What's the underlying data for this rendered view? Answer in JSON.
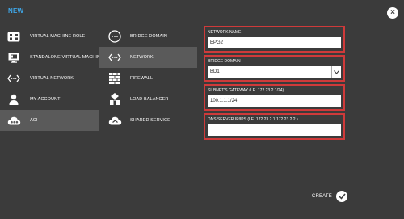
{
  "dialog": {
    "title": "NEW",
    "close_icon": "close-icon"
  },
  "categories": [
    {
      "label": "VIRTUAL MACHINE ROLE",
      "icon": "vm-role-icon",
      "selected": false
    },
    {
      "label": "STANDALONE VIRTUAL MACHINE",
      "icon": "monitor-icon",
      "selected": false
    },
    {
      "label": "VIRTUAL NETWORK",
      "icon": "network-arrows-icon",
      "selected": false
    },
    {
      "label": "MY ACCOUNT",
      "icon": "user-icon",
      "selected": false
    },
    {
      "label": "ACI",
      "icon": "aci-cloud-icon",
      "selected": true
    }
  ],
  "subtypes": [
    {
      "label": "BRIDGE DOMAIN",
      "icon": "bridge-domain-icon",
      "selected": false
    },
    {
      "label": "NETWORK",
      "icon": "network-arrows-icon",
      "selected": true
    },
    {
      "label": "FIREWALL",
      "icon": "firewall-icon",
      "selected": false
    },
    {
      "label": "LOAD BALANCER",
      "icon": "load-balancer-icon",
      "selected": false
    },
    {
      "label": "SHARED SERVICE",
      "icon": "shared-service-icon",
      "selected": false
    }
  ],
  "form": {
    "network_name": {
      "label": "NETWORK NAME",
      "value": "EPG2"
    },
    "bridge_domain": {
      "label": "BRIDGE DOMAIN",
      "value": "BD1"
    },
    "subnet_gateway": {
      "label": "SUBNET'S GATEWAY (I.E. 172.23.2.1/24)",
      "value": "100.1.1.1/24"
    },
    "dns_server": {
      "label": "DNS SERVER IP/IPS (I.E. 172.23.2.1,172.23.2.2 )",
      "value": ""
    }
  },
  "footer": {
    "create_label": "CREATE",
    "create_icon": "checkmark-icon"
  },
  "colors": {
    "background": "#3b3b3b",
    "selected": "#5a5a5a",
    "title": "#3fa7e8",
    "highlight_border": "#cf3a3a"
  }
}
